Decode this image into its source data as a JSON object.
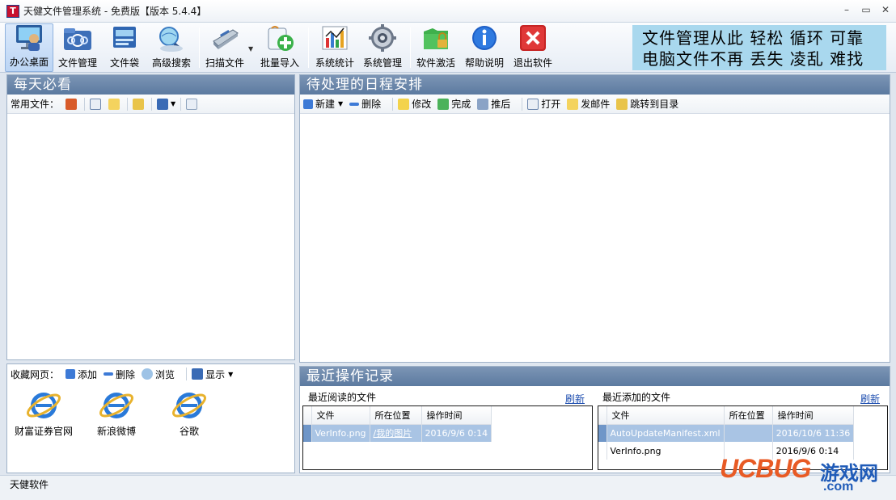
{
  "window": {
    "title": "天健文件管理系统 - 免费版【版本 5.4.4】",
    "app_icon_letter": "T",
    "controls": [
      "–",
      "▭",
      "✕"
    ]
  },
  "toolbar": {
    "buttons": [
      {
        "label": "办公桌面",
        "icon": "desktop-icon",
        "active": true
      },
      {
        "label": "文件管理",
        "icon": "folder-network-icon"
      },
      {
        "label": "文件袋",
        "icon": "document-bag-icon"
      },
      {
        "label": "高级搜索",
        "icon": "search-globe-icon"
      },
      {
        "label": "扫描文件",
        "icon": "scanner-icon"
      },
      {
        "label": "批量导入",
        "icon": "batch-import-icon"
      },
      {
        "label": "系统统计",
        "icon": "statistics-chart-icon"
      },
      {
        "label": "系统管理",
        "icon": "gear-icon"
      },
      {
        "label": "软件激活",
        "icon": "activation-lock-icon"
      },
      {
        "label": "帮助说明",
        "icon": "info-icon"
      },
      {
        "label": "退出软件",
        "icon": "exit-icon"
      }
    ],
    "slogan": [
      "文件管理从此  轻松  循环  可靠",
      "电脑文件不再  丢失  凌乱  难找"
    ]
  },
  "daily": {
    "header": "每天必看",
    "common_files_label": "常用文件："
  },
  "favorites": {
    "label": "收藏网页：",
    "add": "添加",
    "delete": "删除",
    "browse": "浏览",
    "display": "显示",
    "items": [
      "财富证券官网",
      "新浪微博",
      "谷歌"
    ]
  },
  "schedule": {
    "header": "待处理的日程安排",
    "actions": {
      "new": "新建",
      "delete": "删除",
      "edit": "修改",
      "done": "完成",
      "postpone": "推后",
      "open": "打开",
      "email": "发邮件",
      "goto": "跳转到目录"
    }
  },
  "recent": {
    "header": "最近操作记录",
    "read": {
      "title": "最近阅读的文件",
      "refresh": "刷新",
      "columns": [
        "文件",
        "所在位置",
        "操作时间"
      ],
      "rows": [
        [
          "VerInfo.png",
          "/我的图片",
          "2016/9/6 0:14"
        ]
      ]
    },
    "added": {
      "title": "最近添加的文件",
      "refresh": "刷新",
      "columns": [
        "文件",
        "所在位置",
        "操作时间"
      ],
      "rows": [
        [
          "AutoUpdateManifest.xml",
          "",
          "2016/10/6 11:36"
        ],
        [
          "VerInfo.png",
          "",
          "2016/9/6 0:14"
        ]
      ]
    }
  },
  "status": {
    "text": "天健软件"
  },
  "watermark": {
    "brand": "UCBUG",
    "suffix": "游戏网",
    "domain": ".com"
  },
  "colors": {
    "panel_header": "#6b87ab",
    "selection": "#a9c4e4",
    "slogan_bg": "#a9d8ee"
  }
}
